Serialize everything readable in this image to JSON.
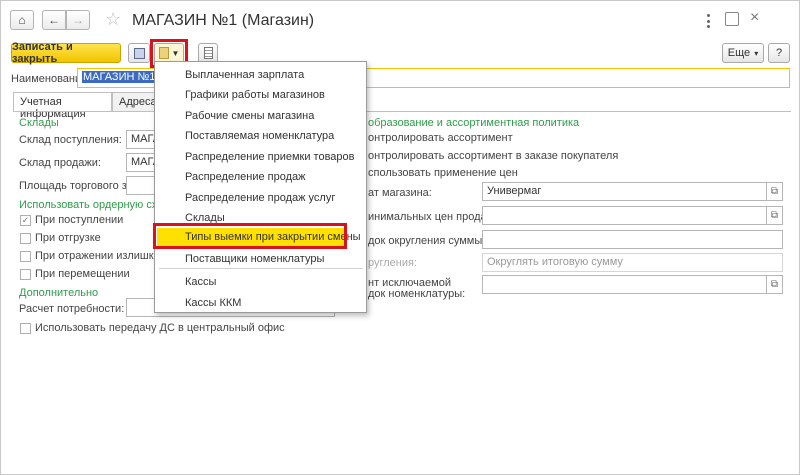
{
  "window": {
    "title": "МАГАЗИН №1 (Магазин)"
  },
  "toolbar": {
    "save_close": "Записать и закрыть",
    "more": "Еще",
    "more_arrow": "▾",
    "help": "?"
  },
  "name_field": {
    "label": "Наименование:",
    "value": "МАГАЗИН №1"
  },
  "tabs": {
    "account": "Учетная информация",
    "address": "Адреса,"
  },
  "left": {
    "warehouses_group": "Склады",
    "recv_label": "Склад поступления:",
    "recv_value": "МАГАЗ",
    "sale_label": "Склад продажи:",
    "sale_value": "МАГАЗ",
    "area_label": "Площадь торгового зала:",
    "order_group": "Использовать ордерную схему",
    "cb1": "При поступлении",
    "cb2": "При отгрузке",
    "cb3": "При отражении излишков и н",
    "cb4": "При перемещении",
    "extra_group": "Дополнительно",
    "calc_label": "Расчет потребности:",
    "transfer_label": "Использовать передачу ДС в центральный офис"
  },
  "right": {
    "group": "образование и ассортиментная политика",
    "line1": "онтролировать ассортимент",
    "line2": "онтролировать ассортимент в заказе покупателя",
    "line3": "спользовать применение цен",
    "format_label": "ат магазина:",
    "format_value": "Универмаг",
    "minprice_label": "инимальных цен продажи:",
    "rounding_label": "док округления суммы чека:",
    "rounding2_label": "ругления:",
    "rounding2_placeholder": "Округлять итоговую сумму",
    "excl_label1": "нт исключаемой",
    "excl_label2": "док номенклатуры:"
  },
  "menu": {
    "items": [
      "Выплаченная зарплата",
      "Графики работы магазинов",
      "Рабочие смены магазина",
      "Поставляемая номенклатура",
      "Распределение приемки товаров",
      "Распределение продаж",
      "Распределение продаж услуг",
      "Склады",
      "Типы выемки при закрытии смены",
      "Поставщики номенклатуры",
      "Кассы",
      "Кассы ККМ"
    ]
  },
  "colors": {
    "accent": "#f2c400",
    "group_green": "#2f9b4a",
    "highlight_red": "#d9121b",
    "highlight_yellow": "#ffe000"
  }
}
